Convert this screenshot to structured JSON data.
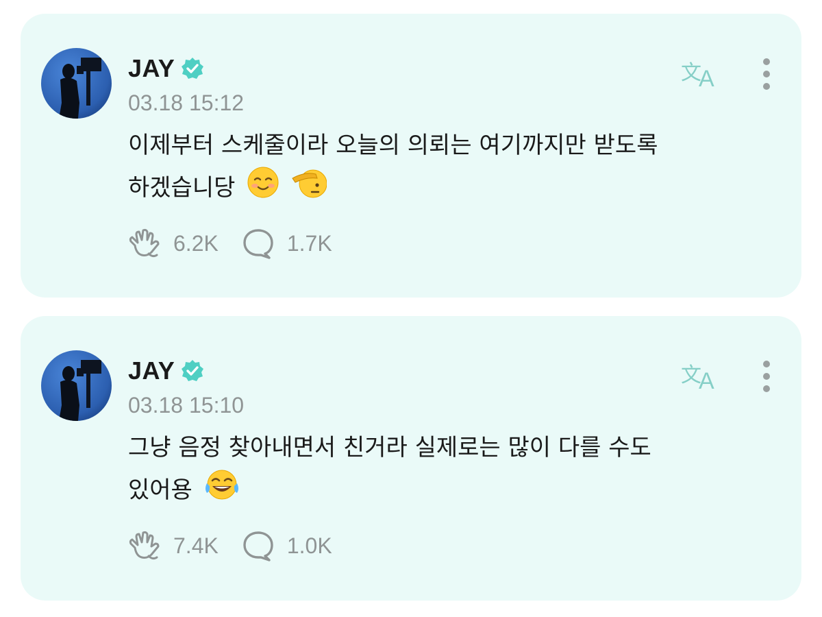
{
  "posts": [
    {
      "author": "JAY",
      "timestamp": "03.18 15:12",
      "text_line1": "이제부터 스케줄이라 오늘의 의뢰는 여기까지만 받도록",
      "text_line2": "하겠습니당",
      "emojis": [
        "smiling-face-icon",
        "saluting-face-icon"
      ],
      "likes": "6.2K",
      "comments": "1.7K"
    },
    {
      "author": "JAY",
      "timestamp": "03.18 15:10",
      "text_line1": "그냥 음정 찾아내면서 친거라 실제로는 많이 다를 수도",
      "text_line2": "있어용",
      "emojis": [
        "tears-of-joy-icon"
      ],
      "likes": "7.4K",
      "comments": "1.0K"
    }
  ],
  "colors": {
    "card_bg": "#eafaf8",
    "accent": "#4fcfc3",
    "muted": "#8f9494",
    "text": "#1a1a1a"
  },
  "icons": {
    "verified": "verified-badge-icon",
    "translate": "translate-icon",
    "more": "more-vertical-icon",
    "like": "like-hand-icon",
    "comment": "comment-bubble-icon"
  }
}
